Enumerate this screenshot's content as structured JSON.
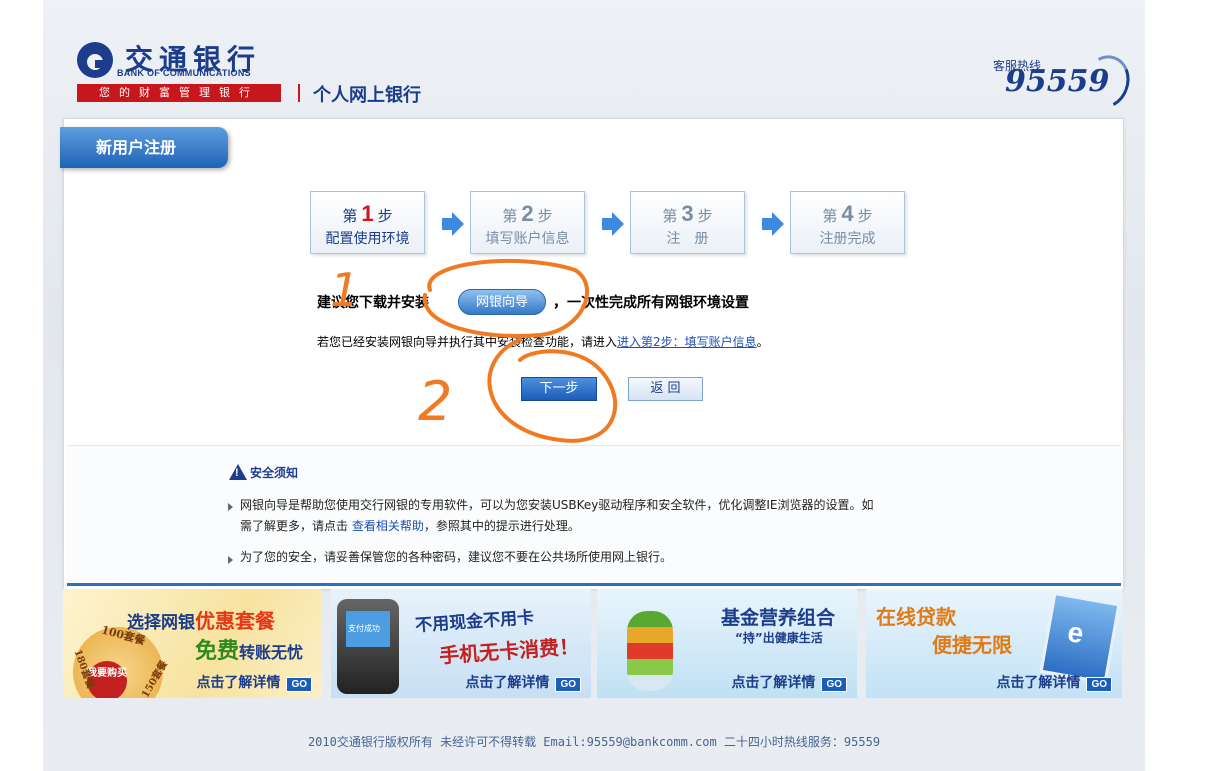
{
  "header": {
    "logo_cn": "交通银行",
    "logo_en": "BANK OF COMMUNICATIONS",
    "slogan": "您的财富管理银行",
    "title": "个人网上银行",
    "hotline_label": "客服热线",
    "hotline_number": "95559"
  },
  "panel": {
    "tab_title": "新用户注册"
  },
  "steps": [
    {
      "prefix": "第",
      "num": "1",
      "suffix": "步",
      "desc": "配置使用环境",
      "active": true
    },
    {
      "prefix": "第",
      "num": "2",
      "suffix": "步",
      "desc": "填写账户信息",
      "active": false
    },
    {
      "prefix": "第",
      "num": "3",
      "suffix": "步",
      "desc": "注　册",
      "active": false
    },
    {
      "prefix": "第",
      "num": "4",
      "suffix": "步",
      "desc": "注册完成",
      "active": false
    }
  ],
  "suggest": {
    "text_before": "建议您下载并安装",
    "wizard_button": "网银向导",
    "text_after": "，一次性完成所有网银环境设置",
    "installed_text": "若您已经安装网银向导并执行其中安装检查功能，请进入",
    "installed_link": "进入第2步：填写账户信息",
    "installed_end": "。"
  },
  "buttons": {
    "next": "下一步",
    "back": "返 回"
  },
  "security": {
    "title": "安全须知",
    "item1_line1": "网银向导是帮助您使用交行网银的专用软件，可以为您安装USBKey驱动程序和安全软件，优化调整IE浏览器的设置。如",
    "item1_line2_before": "需了解更多，请点击 ",
    "item1_link": "查看相关帮助",
    "item1_line2_after": "，参照其中的提示进行处理。",
    "item2": "为了您的安全，请妥善保管您的各种密码，建议您不要在公共场所使用网上银行。"
  },
  "banners": [
    {
      "head_a": "选择网银",
      "head_b": "优惠套餐",
      "sub_a": "免费",
      "sub_b": "转账无忧",
      "disc_text": "我要购买",
      "badge_a": "100套餐",
      "badge_b": "180套餐",
      "badge_c": "150套餐",
      "cta": "点击了解详情",
      "go": "GO"
    },
    {
      "head_a": "不用现金",
      "head_b": "不用卡",
      "sub_a": "手机无卡",
      "sub_b": "消费！",
      "screen": "支付成功",
      "cta": "点击了解详情",
      "go": "GO"
    },
    {
      "head": "基金营养组合",
      "sub": "“持”出健康生活",
      "cta": "点击了解详情",
      "go": "GO"
    },
    {
      "head": "在线贷款",
      "sub": "便捷无限",
      "cta": "点击了解详情",
      "go": "GO"
    }
  ],
  "annotations": {
    "mark1": "1",
    "mark2": "2"
  },
  "footer": {
    "text": "2010交通银行版权所有 未经许可不得转载 Email:95559@bankcomm.com 二十四小时热线服务：95559"
  },
  "colors": {
    "brand_blue": "#1c3d8c",
    "brand_red": "#c8161d",
    "annotation_orange": "#f07a22"
  }
}
